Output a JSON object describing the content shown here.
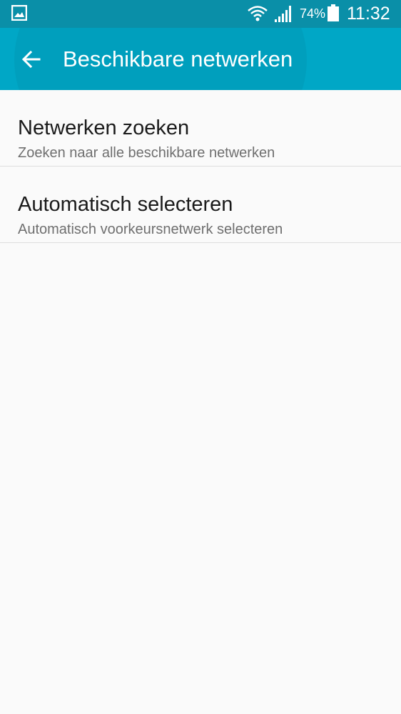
{
  "status_bar": {
    "notification_icon": "image-icon",
    "wifi_icon": "wifi-icon",
    "signal_icon": "signal-icon",
    "battery_percent": "74%",
    "battery_icon": "battery-icon",
    "time": "11:32"
  },
  "app_bar": {
    "back_icon": "arrow-back-icon",
    "title": "Beschikbare netwerken",
    "color": "#00a7c6"
  },
  "list": {
    "items": [
      {
        "title": "Netwerken zoeken",
        "subtitle": "Zoeken naar alle beschikbare netwerken"
      },
      {
        "title": "Automatisch selecteren",
        "subtitle": "Automatisch voorkeursnetwerk selecteren"
      }
    ]
  }
}
